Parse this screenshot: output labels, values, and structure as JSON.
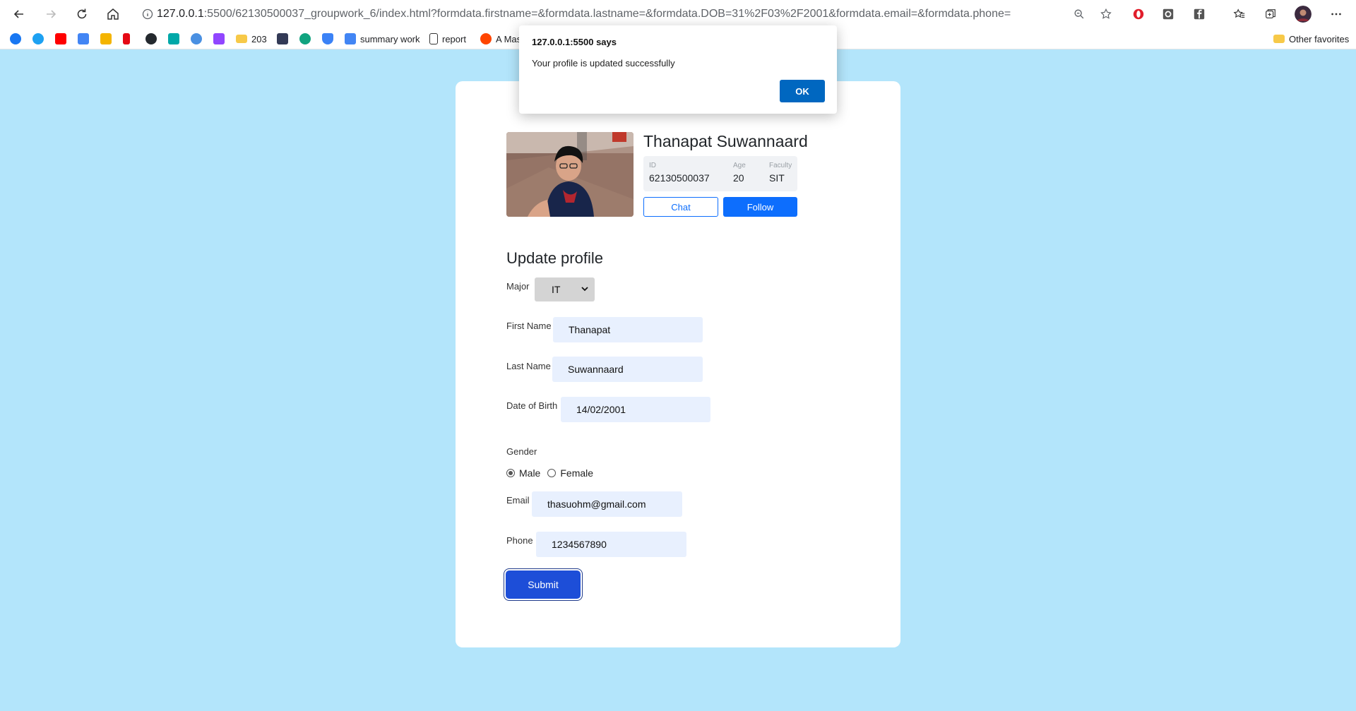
{
  "browser": {
    "url_host": "127.0.0.1",
    "url_rest": ":5500/62130500037_groupwork_6/index.html?formdata.firstname=&formdata.lastname=&formdata.DOB=31%2F03%2F2001&formdata.email=&formdata.phone=",
    "bookmarks": [
      {
        "label": "",
        "color": "#1877f2"
      },
      {
        "label": "",
        "color": "#1da1f2"
      },
      {
        "label": "",
        "color": "#ff0000"
      },
      {
        "label": "",
        "color": "#4285f4"
      },
      {
        "label": "",
        "color": "#f4b400"
      },
      {
        "label": "",
        "color": "#e50914"
      },
      {
        "label": "",
        "color": "#24292e"
      },
      {
        "label": "",
        "color": "#00a8a8"
      },
      {
        "label": "",
        "color": "#4a90e2"
      },
      {
        "label": "",
        "color": "#9146ff"
      },
      {
        "label": "203",
        "color": "#f7c948"
      },
      {
        "label": "",
        "color": "#333a56"
      },
      {
        "label": "",
        "color": "#10a37f"
      },
      {
        "label": "",
        "color": "#3b82f6"
      },
      {
        "label": "summary work",
        "color": "#4285f4"
      },
      {
        "label": "report",
        "color": "#ffffff"
      },
      {
        "label": "A Mas",
        "color": "#ff4500"
      }
    ],
    "other_favorites": "Other favorites"
  },
  "profile": {
    "name": "Thanapat Suwannaard",
    "stats": [
      {
        "label": "ID",
        "value": "62130500037"
      },
      {
        "label": "Age",
        "value": "20"
      },
      {
        "label": "Faculty",
        "value": "SIT"
      }
    ],
    "chat_label": "Chat",
    "follow_label": "Follow"
  },
  "form": {
    "title": "Update profile",
    "major_label": "Major",
    "major_value": "IT",
    "firstname_label": "First Name",
    "firstname_value": "Thanapat",
    "lastname_label": "Last Name",
    "lastname_value": "Suwannaard",
    "dob_label": "Date of Birth",
    "dob_value": "14/02/2001",
    "gender_label": "Gender",
    "gender_male": "Male",
    "gender_female": "Female",
    "gender_selected": "Male",
    "email_label": "Email",
    "email_value": "thasuohm@gmail.com",
    "phone_label": "Phone",
    "phone_value": "1234567890",
    "submit_label": "Submit"
  },
  "dialog": {
    "title": "127.0.0.1:5500 says",
    "message": "Your profile is updated successfully",
    "ok_label": "OK"
  }
}
